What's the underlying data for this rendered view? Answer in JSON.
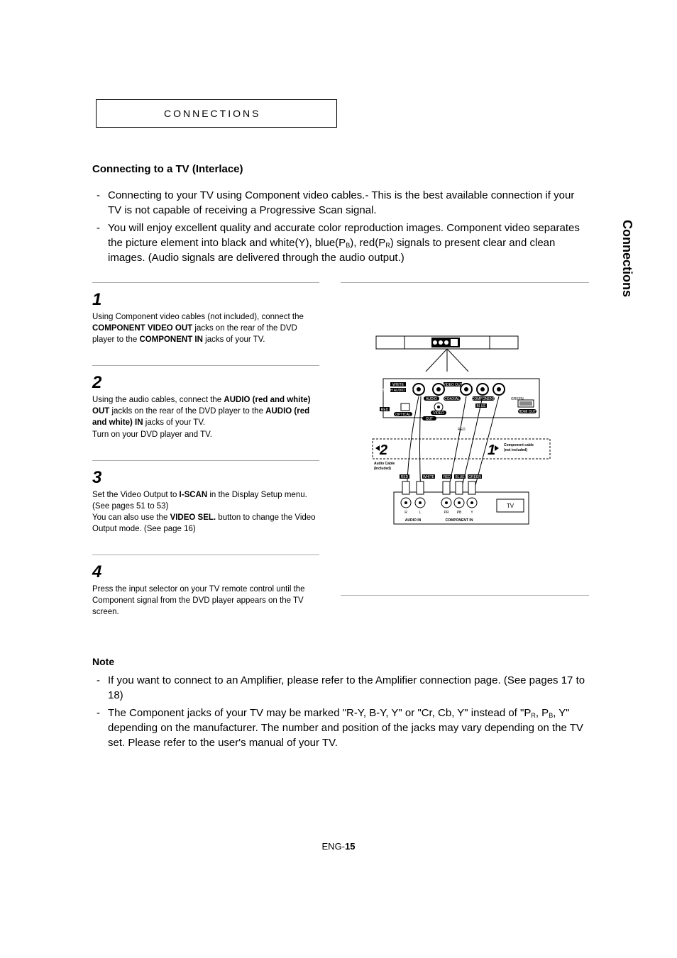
{
  "header": {
    "title": "CONNECTIONS"
  },
  "sideTab": "Connections",
  "subtitle": "Connecting to a TV (Interlace)",
  "intro": [
    {
      "text": "Connecting to your TV using Component video cables.-    This is the best available connection if your TV is not capable of receiving a Progressive Scan signal."
    },
    {
      "prefix": "You will enjoy excellent quality and accurate color reproduction images. Component video separates the picture element into black and white(Y), blue(P",
      "sub1": "B",
      "mid": "), red(P",
      "sub2": "R",
      "suffix": ") signals to present clear and clean images. (Audio signals are delivered through the audio output.)"
    }
  ],
  "steps": [
    {
      "num": "1",
      "runs": [
        {
          "t": "Using Component video cables (not included), connect the "
        },
        {
          "t": "COMPONENT VIDEO OUT",
          "b": true
        },
        {
          "t": " jacks on the rear of the DVD player to the "
        },
        {
          "t": "COMPONENT IN",
          "b": true
        },
        {
          "t": " jacks of your TV."
        }
      ]
    },
    {
      "num": "2",
      "runs": [
        {
          "t": "Using the audio cables, connect the "
        },
        {
          "t": "AUDIO (red and white) OUT",
          "b": true
        },
        {
          "t": " jackls on the rear of the DVD player to the "
        },
        {
          "t": "AUDIO (red and white) IN",
          "b": true
        },
        {
          "t": " jacks of your TV."
        },
        {
          "br": true
        },
        {
          "t": "Turn on your DVD player and TV."
        }
      ]
    },
    {
      "num": "3",
      "runs": [
        {
          "t": "Set the Video Output to "
        },
        {
          "t": "I-SCAN",
          "b": true
        },
        {
          "t": " in the Display Setup menu. (See pages 51 to 53)"
        },
        {
          "br": true
        },
        {
          "t": "You can also use the "
        },
        {
          "t": "VIDEO SEL.",
          "b": true
        },
        {
          "t": " button to change the Video Output mode. (See page 16)"
        }
      ]
    },
    {
      "num": "4",
      "runs": [
        {
          "t": "Press the input selector on your TV remote control until the Component signal from the DVD player appears on the TV screen."
        }
      ]
    }
  ],
  "diagram": {
    "labels": {
      "white": "WHITE",
      "red": "RED",
      "blue": "BLUE",
      "green": "GREEN",
      "audio": "AUDIO",
      "coaxial": "COAXIAL",
      "component": "COMPONENT",
      "video": "VIDEO",
      "optical": "OPTICAL",
      "out": "OUT",
      "hdmi": "HDMI OUT",
      "audioOut": "5.1CH AUDIO OUT",
      "videoOut": "VIDEO OUT",
      "audioIn": "AUDIO IN",
      "componentIn": "COMPONENT IN",
      "tv": "TV",
      "pr": "PR",
      "pb": "PB",
      "y": "Y",
      "r": "R",
      "l": "L",
      "audioCable": "Audio Cable",
      "included": "(Included)",
      "compCable": "Component cable",
      "notIncluded": "(not included)",
      "callout1": "1",
      "callout2": "2"
    }
  },
  "note": {
    "title": "Note",
    "items": [
      {
        "text": "If you want to connect to an Amplifier, please refer to the Amplifier connection page. (See pages 17 to 18)"
      },
      {
        "prefix": "The Component jacks of your TV may be marked \"R-Y, B-Y, Y\" or \"Cr, Cb, Y\" instead of \"P",
        "sub1": "R",
        "mid1": ", P",
        "sub2": "B",
        "mid2": ", Y\" depending on the manufacturer. The number and position of the jacks may vary depending on the TV set. Please refer to the user's manual of your TV."
      }
    ]
  },
  "footer": {
    "prefix": "ENG-",
    "page": "15"
  }
}
